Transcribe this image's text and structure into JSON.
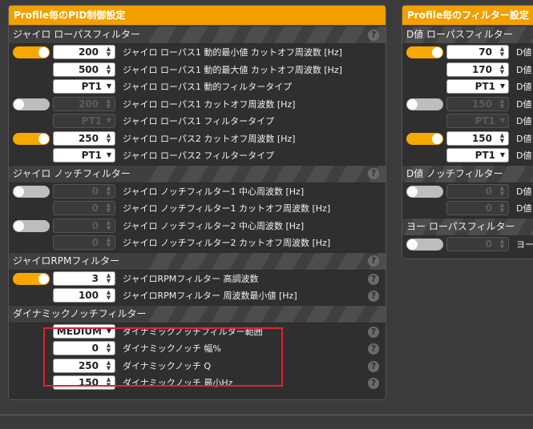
{
  "left": {
    "title": "Profile毎のPID制御設定",
    "help": "?",
    "sections": [
      {
        "title": "ジャイロ ローパスフィルター",
        "rows": [
          {
            "toggle": "on",
            "type": "num",
            "value": "200",
            "label": "ジャイロ ローパス1 動的最小値 カットオフ周波数 [Hz]"
          },
          {
            "type": "num",
            "value": "500",
            "label": "ジャイロ ローパス1 動的最大値 カットオフ周波数 [Hz]"
          },
          {
            "type": "sel",
            "value": "PT1",
            "label": "ジャイロ ローパス1 動的フィルタータイプ"
          },
          {
            "toggle": "off",
            "type": "num",
            "disabled": true,
            "value": "200",
            "label": "ジャイロ ローパス1 カットオフ周波数 [Hz]"
          },
          {
            "type": "sel",
            "disabled": true,
            "value": "PT1",
            "label": "ジャイロ ローパス1 フィルタータイプ"
          },
          {
            "toggle": "on",
            "type": "num",
            "value": "250",
            "label": "ジャイロ ローパス2 カットオフ周波数 [Hz]"
          },
          {
            "type": "sel",
            "value": "PT1",
            "label": "ジャイロ ローパス2 フィルタータイプ"
          }
        ]
      },
      {
        "title": "ジャイロ ノッチフィルター",
        "rows": [
          {
            "toggle": "off",
            "type": "num",
            "disabled": true,
            "value": "0",
            "label": "ジャイロ ノッチフィルター1 中心周波数 [Hz]"
          },
          {
            "type": "num",
            "disabled": true,
            "value": "0",
            "label": "ジャイロ ノッチフィルター1 カットオフ周波数 [Hz]"
          },
          {
            "toggle": "off",
            "type": "num",
            "disabled": true,
            "value": "0",
            "label": "ジャイロ ノッチフィルター2 中心周波数 [Hz]"
          },
          {
            "type": "num",
            "disabled": true,
            "value": "0",
            "label": "ジャイロ ノッチフィルター2 カットオフ周波数 [Hz]"
          }
        ]
      },
      {
        "title": "ジャイロRPMフィルター",
        "rows": [
          {
            "toggle": "on",
            "type": "num",
            "value": "3",
            "label": "ジャイロRPMフィルター 高調波数",
            "help": true
          },
          {
            "type": "num",
            "value": "100",
            "label": "ジャイロRPMフィルター 周波数最小値 [Hz]",
            "help": true
          }
        ]
      },
      {
        "title": "ダイナミックノッチフィルター",
        "nohelp": true,
        "rows": [
          {
            "type": "sel",
            "value": "MEDIUM",
            "label": "ダイナミックノッチフィルター範囲",
            "help": true
          },
          {
            "type": "num",
            "value": "0",
            "label": "ダイナミックノッチ 幅%",
            "help": true
          },
          {
            "type": "num",
            "value": "250",
            "label": "ダイナミックノッチ Q",
            "help": true
          },
          {
            "type": "num",
            "value": "150",
            "label": "ダイナミックノッチ 最小Hz",
            "help": true
          }
        ]
      }
    ]
  },
  "right": {
    "title": "Profile毎のフィルター設定",
    "sections": [
      {
        "title": "D値 ローパスフィルター",
        "rows": [
          {
            "toggle": "on",
            "type": "num",
            "value": "70",
            "label": "D値"
          },
          {
            "type": "num",
            "value": "170",
            "label": "D値"
          },
          {
            "type": "sel",
            "value": "PT1",
            "label": "D値"
          },
          {
            "toggle": "off",
            "type": "num",
            "disabled": true,
            "value": "150",
            "label": "D値"
          },
          {
            "type": "sel",
            "disabled": true,
            "value": "PT1",
            "label": "D値"
          },
          {
            "toggle": "on",
            "type": "num",
            "value": "150",
            "label": "D値"
          },
          {
            "type": "sel",
            "value": "PT1",
            "label": "D値"
          }
        ]
      },
      {
        "title": "D値 ノッチフィルター",
        "rows": [
          {
            "toggle": "off",
            "type": "num",
            "disabled": true,
            "value": "0",
            "label": "D値"
          },
          {
            "type": "num",
            "disabled": true,
            "value": "0",
            "label": "D値"
          }
        ]
      },
      {
        "title": "ヨー ローパスフィルター",
        "rows": [
          {
            "toggle": "off",
            "type": "num",
            "disabled": true,
            "value": "0",
            "label": "ヨー"
          }
        ]
      }
    ]
  }
}
